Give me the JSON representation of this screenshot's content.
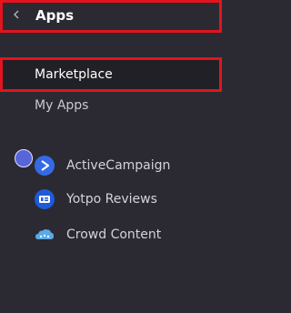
{
  "header": {
    "back_icon": "chevron-left-icon",
    "title": "Apps"
  },
  "nav": {
    "items": [
      {
        "label": "Marketplace",
        "selected": true
      },
      {
        "label": "My Apps",
        "selected": false
      }
    ]
  },
  "user": {
    "avatar_color": "#5865d8"
  },
  "apps": [
    {
      "label": "ActiveCampaign",
      "icon": "activecampaign-icon",
      "icon_color": "#356ae6"
    },
    {
      "label": "Yotpo Reviews",
      "icon": "yotpo-icon",
      "icon_color": "#1f5ad8"
    },
    {
      "label": "Crowd Content",
      "icon": "cloud-icon",
      "icon_color": "#5aa9e6"
    }
  ],
  "colors": {
    "background": "#2b2a33",
    "highlight_border": "#e3141d",
    "selected_background": "#202026"
  }
}
